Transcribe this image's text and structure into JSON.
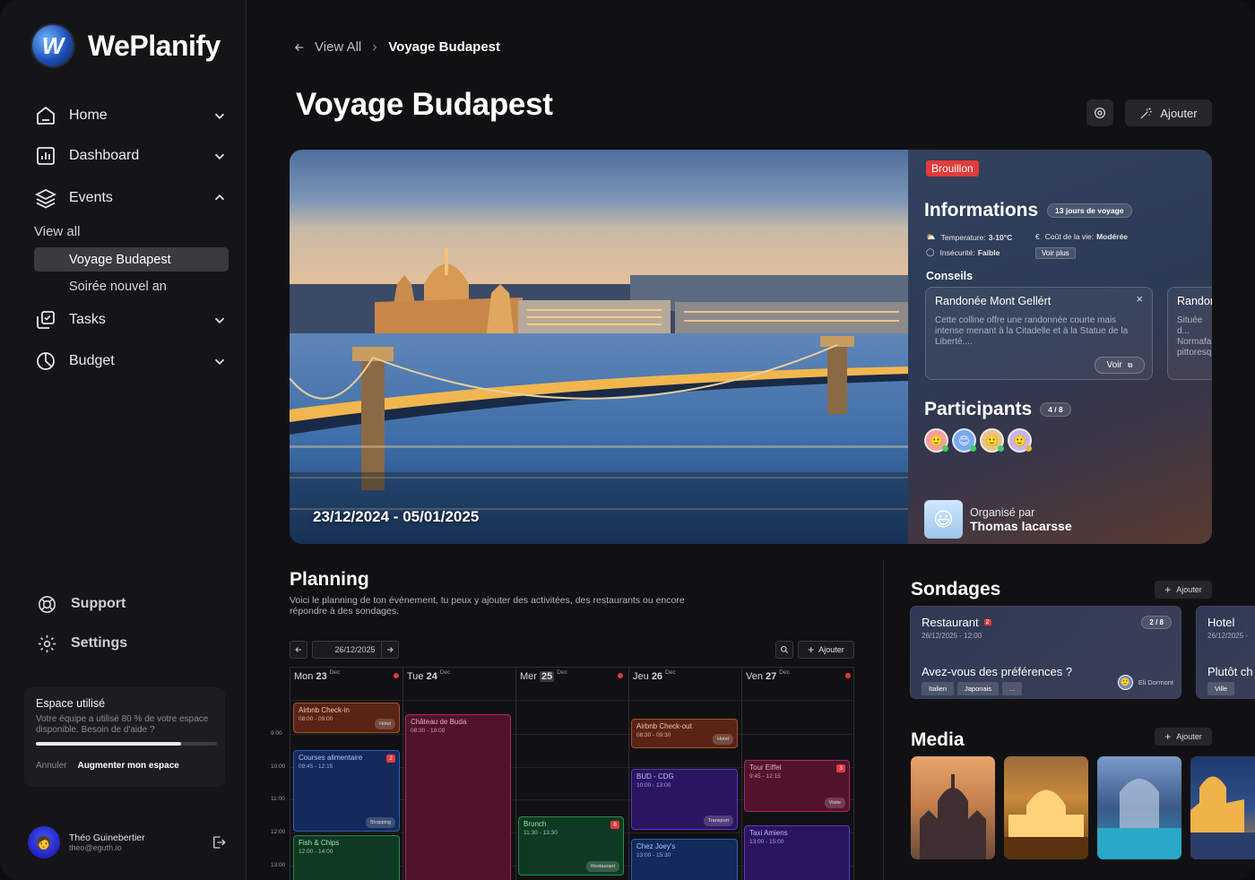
{
  "app": {
    "name": "WePlanify"
  },
  "sidebar": {
    "nav": [
      {
        "label": "Home"
      },
      {
        "label": "Dashboard"
      },
      {
        "label": "Events"
      },
      {
        "label": "Tasks"
      },
      {
        "label": "Budget"
      }
    ],
    "events_view_all": "View all",
    "events_sub": [
      "Voyage Budapest",
      "Soirée nouvel an"
    ],
    "support": "Support",
    "settings": "Settings",
    "storage": {
      "title": "Espace utilisé",
      "text": "Votre équipe a utilisé 80 % de votre espace disponible. Besoin de d'aide ?",
      "percent": 80,
      "cancel": "Annuler",
      "upgrade": "Augmenter mon espace"
    },
    "user": {
      "name": "Théo Guinebertier",
      "email": "theo@eguth.io"
    }
  },
  "breadcrumb": {
    "back": "View All",
    "current": "Voyage Budapest"
  },
  "page": {
    "title": "Voyage Budapest",
    "add_label": "Ajouter"
  },
  "hero": {
    "dates": "23/12/2024 - 05/01/2025",
    "status": "Brouillon",
    "info_title": "Informations",
    "duration": "13 jours de voyage",
    "temp_label": "Temperature:",
    "temp_value": "3-10°C",
    "cost_label": "Coût de la vie:",
    "cost_value": "Modérée",
    "insecurity_label": "Insécurité:",
    "insecurity_value": "Faible",
    "see_more": "Voir plus",
    "tips_title": "Conseils",
    "tips": [
      {
        "title": "Randonée Mont Gellért",
        "text": "Cette colline offre une randonnée courte mais intense menant à la Citadelle et à la Statue de la Liberté....",
        "action": "Voir"
      },
      {
        "title": "Randonée",
        "text": "Située d... Normafa... pittoresq..."
      }
    ],
    "participants_title": "Participants",
    "participants_count": "4 / 8",
    "organized_by": "Organisé par",
    "organizer": "Thomas lacarsse"
  },
  "planning": {
    "title": "Planning",
    "description": "Voici le planning de ton évènement, tu peux y ajouter des activitées, des restaurants ou encore répondre à des sondages.",
    "date": "26/12/2025",
    "add_label": "Ajouter",
    "days": [
      {
        "name": "Mon",
        "num": "23",
        "month": "Dec"
      },
      {
        "name": "Tue",
        "num": "24",
        "month": "Dec"
      },
      {
        "name": "Mer",
        "num": "25",
        "month": "Dec"
      },
      {
        "name": "Jeu",
        "num": "26",
        "month": "Dec"
      },
      {
        "name": "Ven",
        "num": "27",
        "month": "Dec"
      }
    ],
    "times": [
      "9:00",
      "10:00",
      "11:00",
      "12:00",
      "13:00"
    ],
    "events": [
      {
        "title": "Airbnb Check-in",
        "time": "08:00 - 09:00",
        "tag": "Hotel"
      },
      {
        "title": "Courses alimentaire",
        "time": "09:45 - 12:15",
        "tag": "Shopping",
        "badge": "2"
      },
      {
        "title": "Fish & Chips",
        "time": "12:00 - 14:00"
      },
      {
        "title": "Château de Buda",
        "time": "08:30 - 19:00"
      },
      {
        "title": "Brunch",
        "time": "11:30 - 13:30",
        "tag": "Restaurant",
        "badge": "6"
      },
      {
        "title": "Airbnb Check-out",
        "time": "08:30 - 09:30",
        "tag": "Hotel"
      },
      {
        "title": "BUD - CDG",
        "time": "10:00 - 13:00",
        "tag": "Transport"
      },
      {
        "title": "Chez Joey's",
        "time": "13:00 - 15:30"
      },
      {
        "title": "Tour Eiffel",
        "time": "9:45 - 12:15",
        "tag": "Visite",
        "badge": "3"
      },
      {
        "title": "Taxi Amiens",
        "time": "13:00 - 15:00"
      }
    ]
  },
  "polls": {
    "title": "Sondages",
    "add_label": "Ajouter",
    "items": [
      {
        "title": "Restaurant",
        "badge": "2",
        "date": "26/12/2025 - 12:00",
        "count": "2 / 8",
        "question": "Avez-vous des préférences ?",
        "author": "Eli Dormont",
        "choices": [
          "Italien",
          "Japonais",
          "..."
        ]
      },
      {
        "title": "Hotel",
        "date": "26/12/2025 -",
        "question": "Plutôt ch",
        "choices": [
          "Ville"
        ]
      }
    ]
  },
  "media": {
    "title": "Media",
    "add_label": "Ajouter"
  }
}
